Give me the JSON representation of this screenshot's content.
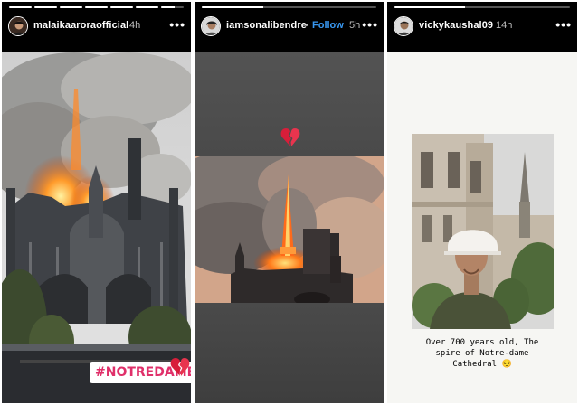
{
  "stories": [
    {
      "username": "malaikaaroraofficial",
      "time": "4h",
      "follow_label": "",
      "more_icon": "more-horizontal-icon",
      "progress": [
        1,
        1,
        1,
        1,
        1,
        1,
        0.6
      ],
      "hashtag": "#NOTREDAME",
      "sticker_icon": "broken-heart-icon"
    },
    {
      "username": "iamsonalibendre",
      "separator": "•",
      "follow_label": "Follow",
      "time": "5h",
      "more_icon": "more-horizontal-icon",
      "progress": [
        0.35
      ],
      "sticker_icon": "broken-heart-icon"
    },
    {
      "username": "vickykaushal09",
      "time": "14h",
      "follow_label": "",
      "more_icon": "more-horizontal-icon",
      "progress": [
        0.4
      ],
      "caption": "Over 700 years old, The\nspire of Notre-dame\nCathedral 😔"
    }
  ],
  "colors": {
    "follow_blue": "#3897f0",
    "time_gray": "#bdbdbd",
    "hashtag_pink": "#e0306a",
    "fire": "#ff7a1a"
  }
}
